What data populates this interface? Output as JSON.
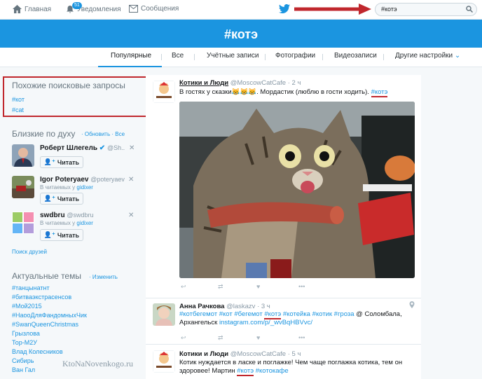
{
  "nav": {
    "home": "Главная",
    "notifications": "Уведомления",
    "notifications_badge": "51",
    "messages": "Сообщения"
  },
  "search": {
    "value": "#котэ"
  },
  "banner": {
    "title": "#котэ"
  },
  "tabs": [
    {
      "label": "Популярные"
    },
    {
      "label": "Все"
    },
    {
      "label": "Учётные записи"
    },
    {
      "label": "Фотографии"
    },
    {
      "label": "Видеозаписи"
    },
    {
      "label": "Другие настройки"
    }
  ],
  "similar": {
    "title": "Похожие поисковые запросы",
    "items": [
      "#кот",
      "#cat"
    ]
  },
  "wtf": {
    "title": "Близкие по духу",
    "refresh": "Обновить",
    "all": "Все",
    "follow_label": "Читать",
    "people": [
      {
        "name": "Роберт Шлегель",
        "handle": "@Sh..",
        "sub": "",
        "sub_user": ""
      },
      {
        "name": "Igor Poteryaev",
        "handle": "@poteryaev",
        "sub": "В читаемых у",
        "sub_user": "gidixer"
      },
      {
        "name": "swdbru",
        "handle": "@swdbru",
        "sub": "В читаемых у",
        "sub_user": "gidixer"
      }
    ],
    "find_friends": "Поиск друзей"
  },
  "trends": {
    "title": "Актуальные темы",
    "change": "Изменить",
    "items": [
      "#танцынатнт",
      "#битваэкстрасенсов",
      "#Мой2015",
      "#НаооДляФандомныхЧик",
      "#SwanQueenChristmas",
      "Грызлова",
      "Тор-М2У",
      "Влад Колесников",
      "Сибирь",
      "Ван Гал"
    ]
  },
  "watermark": "KtoNaNovenkogo.ru",
  "tweets": [
    {
      "name": "Котики и Люди",
      "handle": "@MoscowCatCafe",
      "time": "· 2 ч",
      "text_a": "В гостях у сказки😹😹😹. Мордастик (люблю в гости ходить).",
      "tag": "#котэ"
    },
    {
      "name": "Анна Рачкова",
      "handle": "@laskazv",
      "time": "· 3 ч",
      "tags_a": "#котбегемот #кот #бегемот",
      "tag": "#котэ",
      "tags_b": "#котейка #котик #гроза",
      "text_b": "@ Соломбала, Архангельск",
      "link": "instagram.com/p/_wvBqHBVvc/"
    },
    {
      "name": "Котики и Люди",
      "handle": "@MoscowCatCafe",
      "time": "· 5 ч",
      "text_a": "Котик нуждается в ласке и поглажке! Чем чаще поглажка котика, тем он здоровее! Мартин",
      "tag": "#котэ",
      "tag2": "#котокафе"
    }
  ],
  "colors": {
    "accent": "#1b95e0",
    "highlight": "#c0272d"
  }
}
